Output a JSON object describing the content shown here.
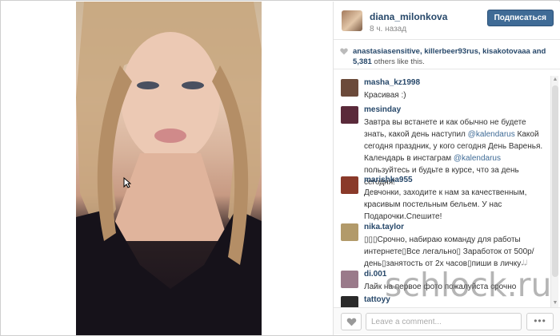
{
  "post": {
    "username": "diana_milonkova",
    "time_ago": "8 ч. назад",
    "follow_label": "Подписаться"
  },
  "likes": {
    "likers_line1": "anastasiasensitive, killerbeer93rus, kisakotovaaa and",
    "count_text": "5,381",
    "others_text": "others like this."
  },
  "comments": [
    {
      "user": "masha_kz1998",
      "text": "Красивая :)",
      "avatar_color": "#6b4a3a"
    },
    {
      "user": "mesinday",
      "text_parts": [
        "Завтра вы встанете и как обычно не будете знать, какой день наступил ",
        "@kalendarus",
        " Какой сегодня праздник, у кого сегодня День Варенья. Календарь в инстаграм ",
        "@kalendarus",
        " пользуйтесь и будьте в курсе, что за день сегодня!"
      ],
      "avatar_color": "#5a2a3a"
    },
    {
      "user": "marishka955",
      "text": "Девчонки, заходите к нам за качественным, красивым постельным бельем. У нас Подарочки.Спешите!",
      "avatar_color": "#8a3a2a"
    },
    {
      "user": "nika.taylor",
      "text": "▯▯▯Срочно, набираю команду для работы интернете▯Все легально▯ Заработок от 500р/день▯занятость от 2х часов▯пиши в личку𝆹𝅥𝆹𝅥",
      "avatar_color": "#b29a6a"
    },
    {
      "user": "di.001",
      "text": "Лайк на первое фото пожалуйста срочно",
      "avatar_color": "#9a7a8a"
    },
    {
      "user": "tattoyy",
      "text": "",
      "avatar_color": "#2a2a2a"
    }
  ],
  "footer": {
    "comment_placeholder": "Leave a comment...",
    "more_label": "•••"
  },
  "watermark": "schlock.ru",
  "colors": {
    "link": "#27486a",
    "follow_button": "#3f6b96"
  }
}
